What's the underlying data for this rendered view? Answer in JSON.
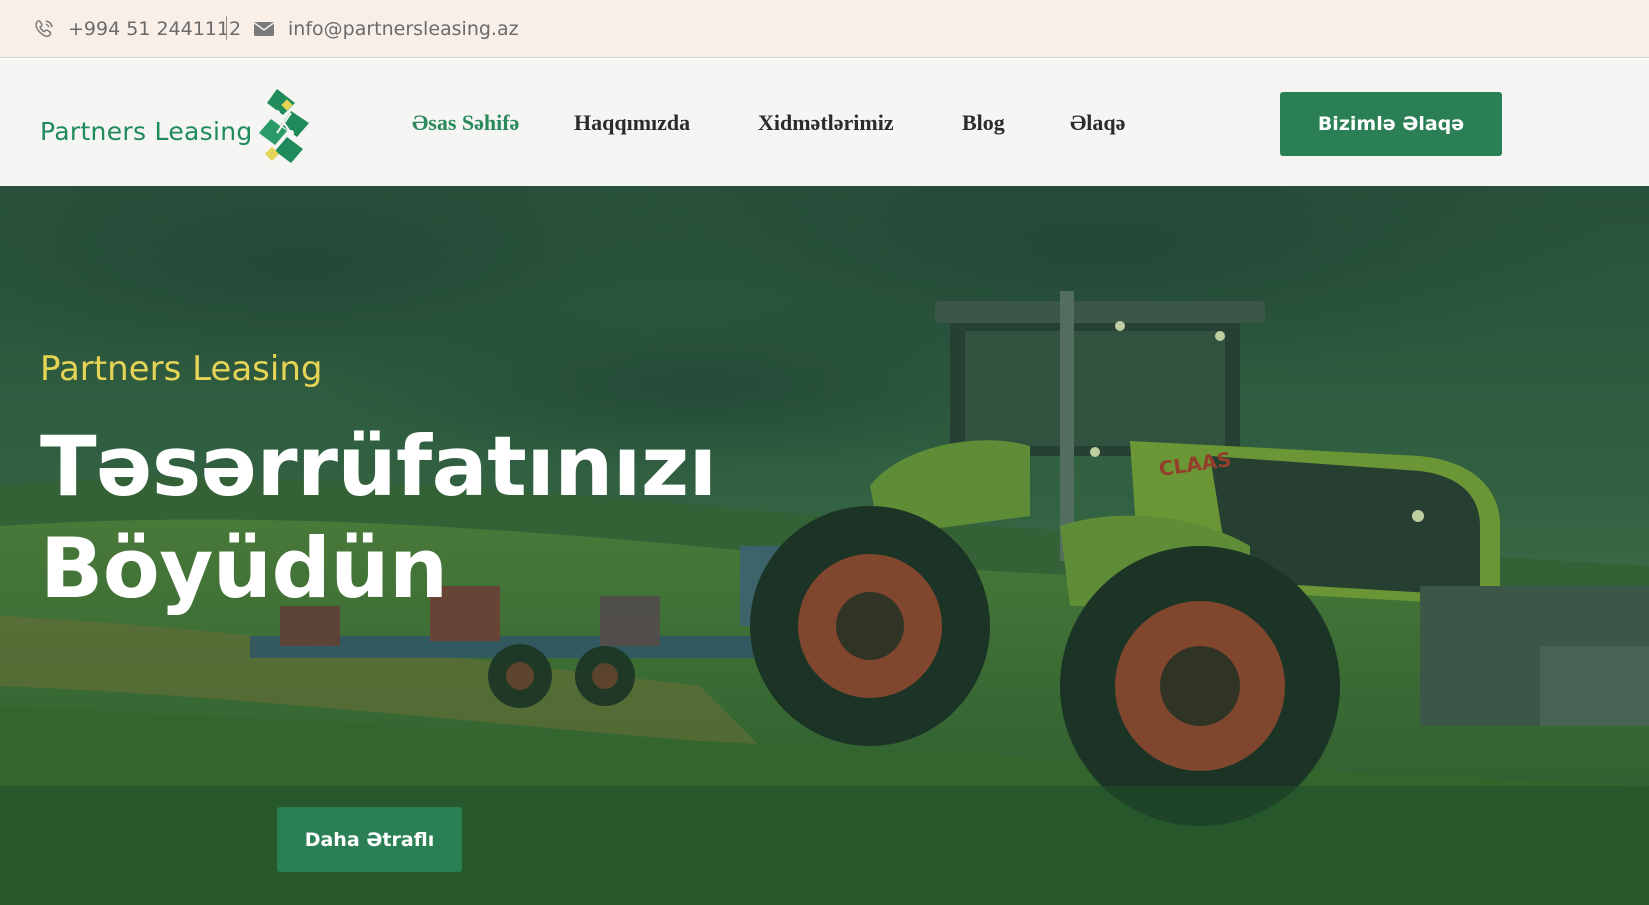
{
  "topbar": {
    "phone": "+994 51 2441112",
    "email": "info@partnersleasing.az",
    "phone_icon": "phone-icon",
    "email_icon": "envelope-icon"
  },
  "header": {
    "logo_text": "Partners Leasing",
    "nav": [
      {
        "label": "Əsas Səhifə",
        "active": true
      },
      {
        "label": "Haqqımızda",
        "active": false
      },
      {
        "label": "Xidmətlərimiz",
        "active": false
      },
      {
        "label": "Blog",
        "active": false
      },
      {
        "label": "Əlaqə",
        "active": false
      }
    ],
    "cta_label": "Bizimlə Əlaqə"
  },
  "hero": {
    "eyebrow": "Partners Leasing",
    "title_line1": "Təsərrüfatınızı",
    "title_line2": "Böyüdün",
    "button_label": "Daha Ətraflı"
  },
  "colors": {
    "brand_green": "#2a7f54",
    "accent_yellow": "#e6d456",
    "topbar_bg": "#f8efe9",
    "nav_bg": "#f5f5f3"
  }
}
